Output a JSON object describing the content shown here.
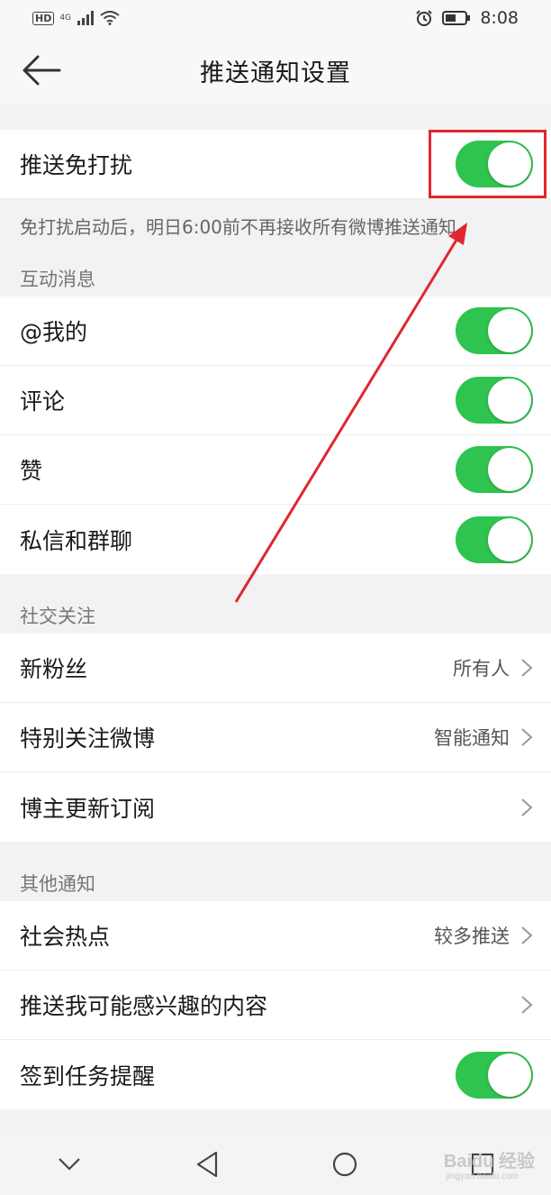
{
  "status": {
    "hd": "HD",
    "network": "4G",
    "time": "8:08"
  },
  "header": {
    "title": "推送通知设置"
  },
  "dnd": {
    "label": "推送免打扰",
    "enabled": true,
    "hint": "免打扰启动后，明日6:00前不再接收所有微博推送通知"
  },
  "sections": {
    "interactive": "互动消息",
    "social": "社交关注",
    "other": "其他通知"
  },
  "interactive": {
    "mentions": {
      "label": "@我的",
      "enabled": true
    },
    "comments": {
      "label": "评论",
      "enabled": true
    },
    "likes": {
      "label": "赞",
      "enabled": true
    },
    "messages": {
      "label": "私信和群聊",
      "enabled": true
    }
  },
  "social": {
    "fans": {
      "label": "新粉丝",
      "value": "所有人"
    },
    "special": {
      "label": "特别关注微博",
      "value": "智能通知"
    },
    "subscribe": {
      "label": "博主更新订阅",
      "value": ""
    }
  },
  "other": {
    "hot": {
      "label": "社会热点",
      "value": "较多推送"
    },
    "interest": {
      "label": "推送我可能感兴趣的内容",
      "value": ""
    },
    "checkin": {
      "label": "签到任务提醒",
      "enabled": true
    }
  },
  "watermark": {
    "line1": "Baidu 经验",
    "line2": "jingyan.baidu.com"
  },
  "colors": {
    "toggle_on": "#2ec44f",
    "annotation": "#e0262e"
  }
}
